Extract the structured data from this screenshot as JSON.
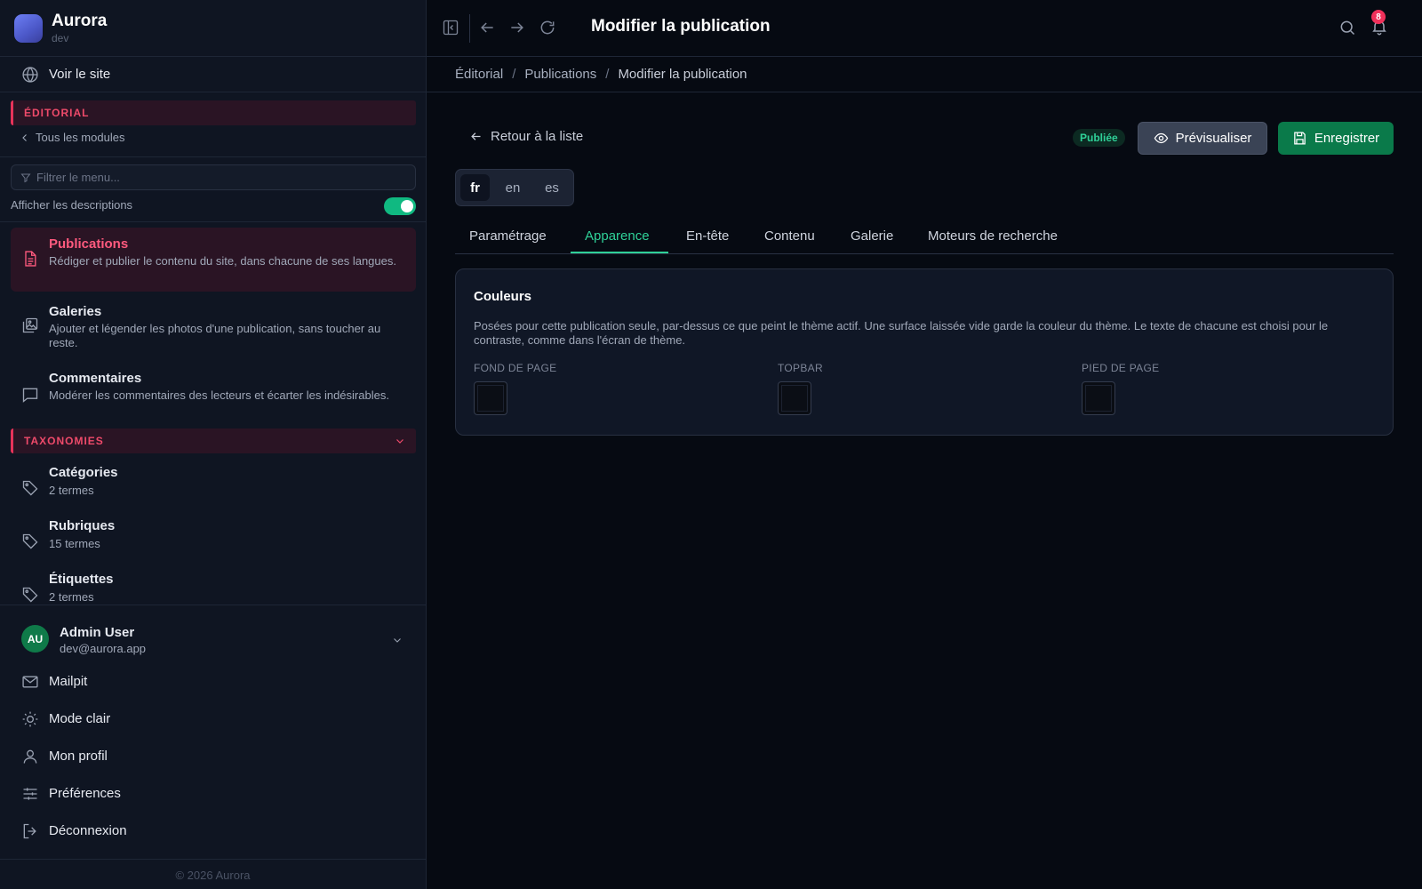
{
  "brand": {
    "name": "Aurora",
    "env": "dev"
  },
  "sidebar": {
    "view_site": "Voir le site",
    "editorial_section": "ÉDITORIAL",
    "all_modules": "Tous les modules",
    "filter_placeholder": "Filtrer le menu...",
    "show_descriptions": "Afficher les descriptions",
    "show_descriptions_on": true,
    "items": [
      {
        "title": "Publications",
        "desc": "Rédiger et publier le contenu du site, dans chacune de ses langues.",
        "icon": "document-icon",
        "active": true
      },
      {
        "title": "Galeries",
        "desc": "Ajouter et légender les photos d'une publication, sans toucher au reste.",
        "icon": "gallery-icon",
        "active": false
      },
      {
        "title": "Commentaires",
        "desc": "Modérer les commentaires des lecteurs et écarter les indésirables.",
        "icon": "comment-icon",
        "active": false
      }
    ],
    "taxonomies_section": "TAXONOMIES",
    "taxonomies": [
      {
        "title": "Catégories",
        "count": "2 termes"
      },
      {
        "title": "Rubriques",
        "count": "15 termes"
      },
      {
        "title": "Étiquettes",
        "count": "2 termes"
      }
    ],
    "user": {
      "initials": "AU",
      "name": "Admin User",
      "email": "dev@aurora.app"
    },
    "footer_items": [
      {
        "label": "Mailpit",
        "icon": "mail-icon"
      },
      {
        "label": "Mode clair",
        "icon": "sun-icon"
      },
      {
        "label": "Mon profil",
        "icon": "user-icon"
      },
      {
        "label": "Préférences",
        "icon": "sliders-icon"
      },
      {
        "label": "Déconnexion",
        "icon": "logout-icon"
      }
    ],
    "copyright": "© 2026 Aurora"
  },
  "topbar": {
    "title": "Modifier la publication",
    "notifications": "8"
  },
  "breadcrumb": [
    "Éditorial",
    "Publications",
    "Modifier la publication"
  ],
  "main": {
    "back": "Retour à la liste",
    "status": "Publiée",
    "preview": "Prévisualiser",
    "save": "Enregistrer",
    "languages": [
      "fr",
      "en",
      "es"
    ],
    "active_language": "fr",
    "tabs": [
      "Paramétrage",
      "Apparence",
      "En-tête",
      "Contenu",
      "Galerie",
      "Moteurs de recherche"
    ],
    "active_tab": "Apparence",
    "card": {
      "title": "Couleurs",
      "desc": "Posées pour cette publication seule, par-dessus ce que peint le thème actif. Une surface laissée vide garde la couleur du thème. Le texte de chacune est choisi pour le contraste, comme dans l'écran de thème.",
      "fields": [
        "FOND DE PAGE",
        "TOPBAR",
        "PIED DE PAGE"
      ]
    }
  },
  "colors": {
    "accent_green": "#2fd198",
    "accent_red": "#ee4a6a",
    "save_button": "#0a7a4a"
  }
}
